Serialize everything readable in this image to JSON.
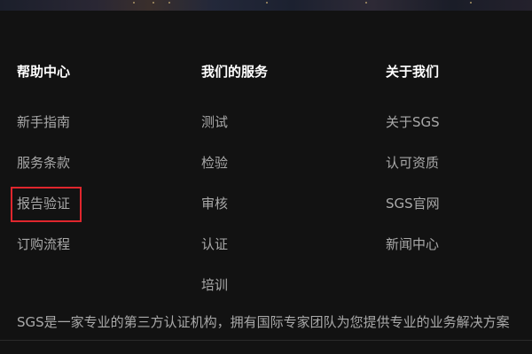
{
  "footer": {
    "columns": [
      {
        "title": "帮助中心",
        "links": [
          "新手指南",
          "服务条款",
          "报告验证",
          "订购流程"
        ]
      },
      {
        "title": "我们的服务",
        "links": [
          "测试",
          "检验",
          "审核",
          "认证",
          "培训"
        ]
      },
      {
        "title": "关于我们",
        "links": [
          "关于SGS",
          "认可资质",
          "SGS官网",
          "新闻中心"
        ]
      }
    ],
    "highlighted_link": "报告验证",
    "description": "SGS是一家专业的第三方认证机构，拥有国际专家团队为您提供专业的业务解决方案"
  },
  "colors": {
    "background": "#121212",
    "title": "#ffffff",
    "link": "#a9a9a9",
    "highlight": "#e0262d"
  }
}
